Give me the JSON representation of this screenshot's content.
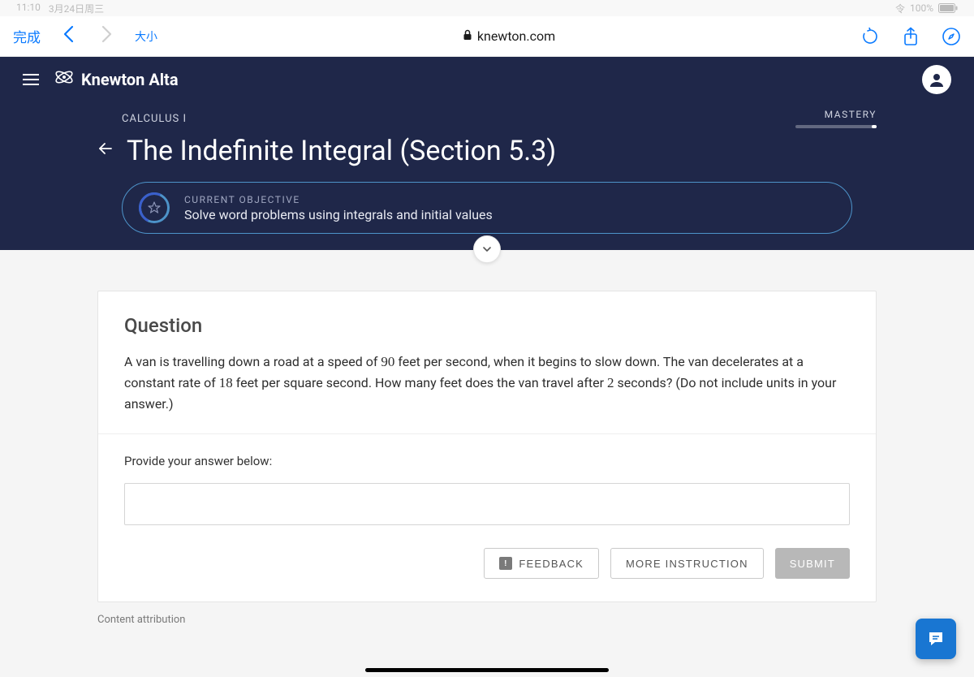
{
  "status": {
    "time": "11:10",
    "date": "3月24日周三",
    "network": "令",
    "battery": "100%"
  },
  "safari": {
    "done": "完成",
    "size": "大小",
    "url": "knewton.com"
  },
  "app": {
    "brand": "Knewton Alta",
    "course": "CALCULUS I",
    "mastery_label": "MASTERY",
    "title": "The Indefinite Integral (Section 5.3)",
    "objective": {
      "label": "CURRENT OBJECTIVE",
      "text": "Solve word problems using integrals and initial values"
    }
  },
  "question": {
    "heading": "Question",
    "body_pre": "A van is travelling down a road at a speed of ",
    "v0": "90",
    "body_mid1": " feet per second, when it begins to slow down. The van decelerates at a constant rate of ",
    "decel": "18",
    "body_mid2": " feet per square second. How many feet does the van travel after ",
    "t": "2",
    "body_post": " seconds? (Do not include units in your answer.)",
    "prompt": "Provide your answer below:",
    "answer_value": ""
  },
  "buttons": {
    "feedback": "FEEDBACK",
    "more": "MORE INSTRUCTION",
    "submit": "SUBMIT"
  },
  "footer": {
    "attribution": "Content attribution"
  }
}
